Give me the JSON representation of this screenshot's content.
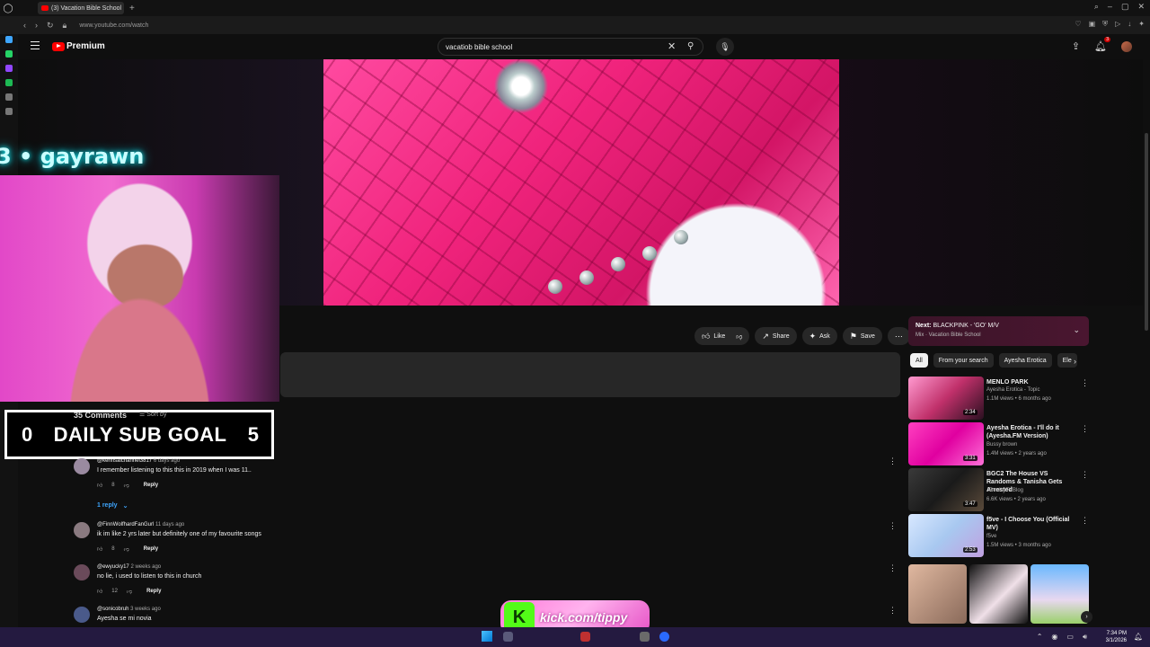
{
  "browser": {
    "tab_title": "(3) Vacation Bible School",
    "url": "www.youtube.com/watch"
  },
  "header": {
    "logo_text": "Premium",
    "search_value": "vacatiob bible school",
    "notification_count": "3"
  },
  "overlay": {
    "streamer_name": "3 • gayrawn",
    "sub_goal": {
      "start": "0",
      "label": "DAILY SUB GOAL",
      "end": "5"
    },
    "kick_url": "kick.com/tippy"
  },
  "actions": {
    "like": "Like",
    "share": "Share",
    "ask": "Ask",
    "save": "Save"
  },
  "comments": {
    "header": "35 Comments",
    "sort_label": "Sort by",
    "items": [
      {
        "author": "@kennsaichannel3817",
        "time": "6 days ago",
        "text": "I remember listening to this this in 2019 when I was 11..",
        "likes": "8",
        "reply": "Reply"
      },
      {
        "author": "@FinnWolfhardFanGurl",
        "time": "11 days ago",
        "text": "ik im like 2 yrs later but definitely one of my favourite songs",
        "likes": "8",
        "reply": "Reply"
      },
      {
        "author": "@ewyucky17",
        "time": "2 weeks ago",
        "text": "no lie, i used to listen to this in church",
        "likes": "12",
        "reply": "Reply"
      },
      {
        "author": "@sonicobruh",
        "time": "3 weeks ago",
        "text": "Ayesha se mi novia"
      }
    ],
    "replies_label": "1 reply"
  },
  "sidebar": {
    "next": {
      "prefix": "Next:",
      "title": "BLACKPINK - 'GO' M/V",
      "sub": "Mix · Vacation Bible School"
    },
    "chips": [
      "All",
      "From your search",
      "Ayesha Erotica",
      "Ele"
    ],
    "recommendations": [
      {
        "title": "MENLO PARK",
        "channel": "Ayesha Erotica - Topic",
        "views": "1.1M views • 6 months ago",
        "duration": "2:34"
      },
      {
        "title": "Ayesha Erotica - I'll do it (Ayesha.FM Version)",
        "channel": "Bussy brown",
        "views": "1.4M views • 2 years ago",
        "duration": "3:31"
      },
      {
        "title": "BGC2 The House VS Randoms & Tanisha Gets Arrested",
        "channel": "JRealityTVBlog",
        "views": "6.6K views • 2 years ago",
        "duration": "3:47"
      },
      {
        "title": "f5ve - I Choose You (Official MV)",
        "channel": "f5ve",
        "views": "1.5M views • 3 months ago",
        "duration": "2:53"
      }
    ]
  },
  "taskbar": {
    "time": "7:34 PM",
    "date": "3/1/2026"
  }
}
